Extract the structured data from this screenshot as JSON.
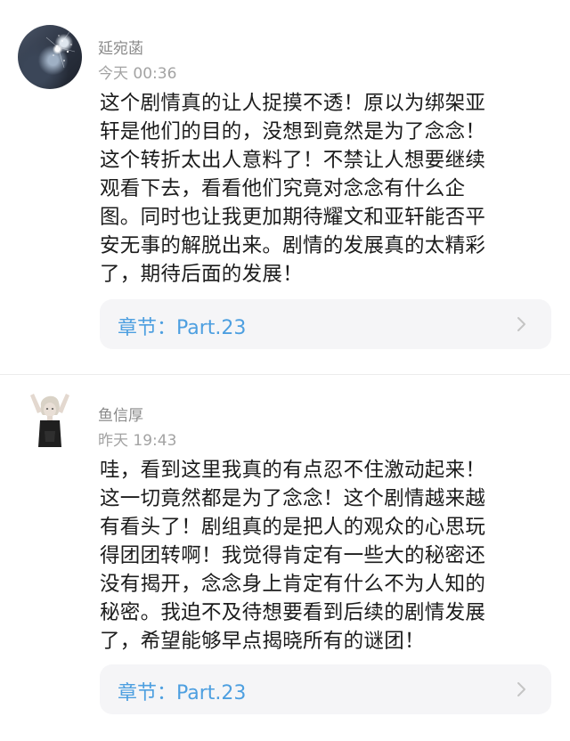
{
  "comments": [
    {
      "username": "延宛菡",
      "timestamp": "今天  00:36",
      "lines": [
        "这个剧情真的让人捉摸不透！原以为绑架亚",
        "轩是他们的目的，没想到竟然是为了念念！",
        "这个转折太出人意料了！不禁让人想要继续",
        "观看下去，看看他们究竟对念念有什么企",
        "图。同时也让我更加期待耀文和亚轩能否平",
        "安无事的解脱出来。剧情的发展真的太精彩",
        "了，期待后面的发展！"
      ],
      "chapter": "章节：Part.23",
      "avatar_icon": "nebula-avatar"
    },
    {
      "username": "鱼信厚",
      "timestamp": "昨天  19:43",
      "lines": [
        "哇，看到这里我真的有点忍不住激动起来！",
        "这一切竟然都是为了念念！这个剧情越来越",
        "有看头了！剧组真的是把人的观众的心思玩",
        "得团团转啊！我觉得肯定有一些大的秘密还",
        "没有揭开，念念身上肯定有什么不为人知的",
        "秘密。我迫不及待想要看到后续的剧情发展",
        "了，希望能够早点揭晓所有的谜团！"
      ],
      "chapter": "章节：Part.23",
      "avatar_icon": "person-avatar"
    }
  ],
  "colors": {
    "chapter_text": "#4d9fe0",
    "card_background": "#f5f5f7",
    "meta_text": "#8a8a8a"
  }
}
